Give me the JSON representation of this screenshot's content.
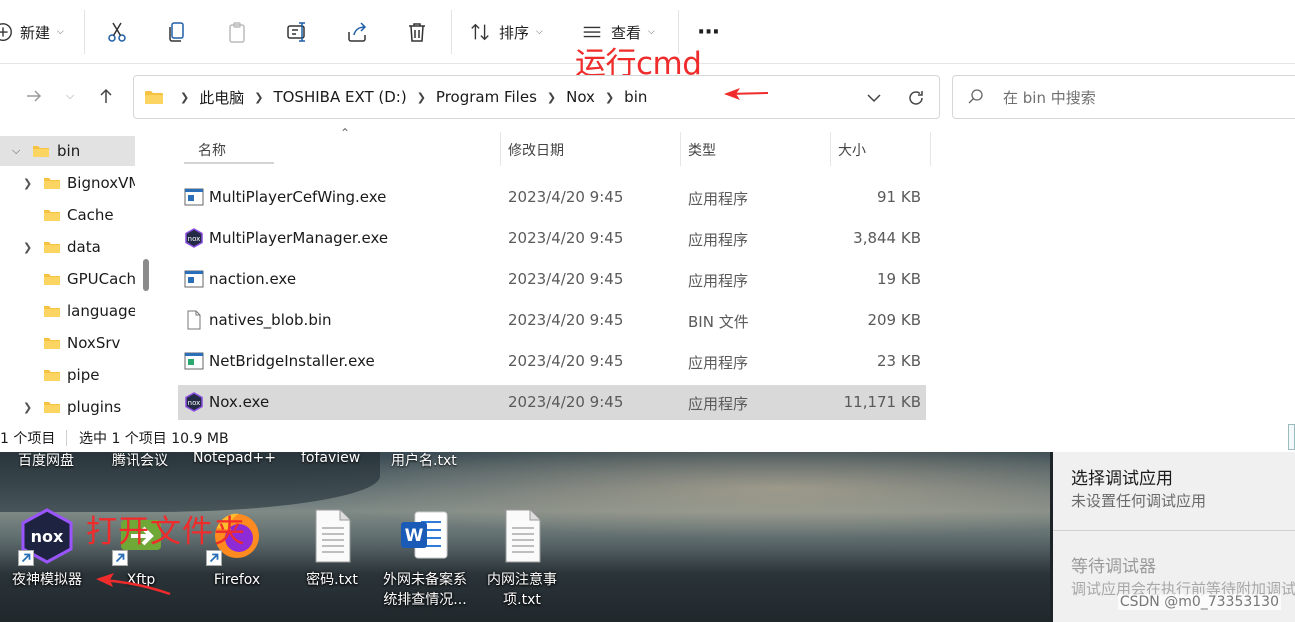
{
  "toolbar": {
    "new_label": "新建",
    "sort_label": "排序",
    "view_label": "查看",
    "more_label": "···"
  },
  "address": {
    "crumbs": [
      "此电脑",
      "TOSHIBA EXT (D:)",
      "Program Files",
      "Nox",
      "bin"
    ]
  },
  "search": {
    "placeholder": "在 bin 中搜索"
  },
  "annotations": {
    "run_cmd": "运行cmd",
    "open_folder": "打开文件夹"
  },
  "sidebar": {
    "items": [
      {
        "label": "bin",
        "expanded": true,
        "selected": true
      },
      {
        "label": "BignoxVMS",
        "has_children": true
      },
      {
        "label": "Cache"
      },
      {
        "label": "data",
        "has_children": true
      },
      {
        "label": "GPUCache"
      },
      {
        "label": "language"
      },
      {
        "label": "NoxSrv"
      },
      {
        "label": "pipe"
      },
      {
        "label": "plugins",
        "has_children": true
      }
    ]
  },
  "columns": {
    "name": "名称",
    "date": "修改日期",
    "type": "类型",
    "size": "大小"
  },
  "files": [
    {
      "name": "MultiPlayerCefWing.exe",
      "date": "2023/4/20 9:45",
      "type": "应用程序",
      "size": "91 KB",
      "icon": "exe-window-icon"
    },
    {
      "name": "MultiPlayerManager.exe",
      "date": "2023/4/20 9:45",
      "type": "应用程序",
      "size": "3,844 KB",
      "icon": "nox-icon"
    },
    {
      "name": "naction.exe",
      "date": "2023/4/20 9:45",
      "type": "应用程序",
      "size": "19 KB",
      "icon": "exe-window-icon"
    },
    {
      "name": "natives_blob.bin",
      "date": "2023/4/20 9:45",
      "type": "BIN 文件",
      "size": "209 KB",
      "icon": "blank-file-icon"
    },
    {
      "name": "NetBridgeInstaller.exe",
      "date": "2023/4/20 9:45",
      "type": "应用程序",
      "size": "23 KB",
      "icon": "exe-window-icon"
    },
    {
      "name": "Nox.exe",
      "date": "2023/4/20 9:45",
      "type": "应用程序",
      "size": "11,171 KB",
      "icon": "nox-icon",
      "selected": true
    }
  ],
  "status": {
    "count": "1 个项目",
    "selection": "选中 1 个项目  10.9 MB"
  },
  "desktop": {
    "top_labels": [
      "百度网盘",
      "腾讯会议",
      "Notepad++",
      "fofaview",
      "用户名.txt"
    ],
    "icons": [
      {
        "label": "夜神模拟器",
        "icon": "nox-icon"
      },
      {
        "label": "Xftp",
        "icon": "xftp-icon"
      },
      {
        "label": "Firefox",
        "icon": "firefox-icon"
      },
      {
        "label": "密码.txt",
        "icon": "text-file-icon"
      },
      {
        "label": "外网未备案系统排查情况...",
        "icon": "word-icon"
      },
      {
        "label": "内网注意事项.txt",
        "icon": "text-file-icon"
      }
    ]
  },
  "debug_panel": {
    "title1": "选择调试应用",
    "sub1": "未设置任何调试应用",
    "title2": "等待调试器",
    "sub2": "调试应用会在执行前等待附加调试器"
  },
  "watermark": "CSDN @m0_73353130"
}
